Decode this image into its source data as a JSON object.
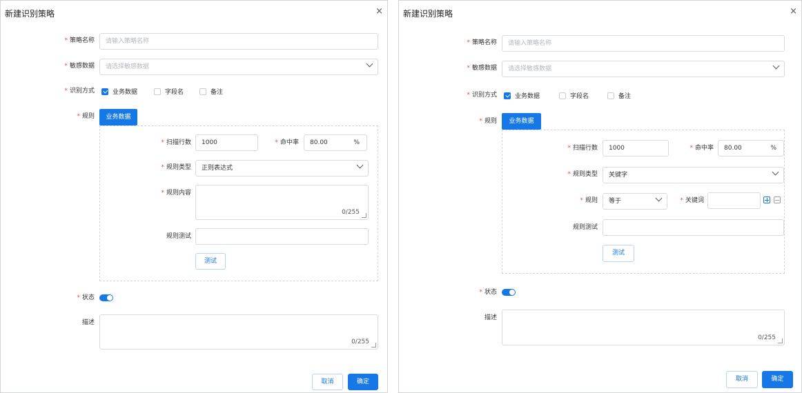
{
  "dialogs": [
    {
      "title": "新建识别策略",
      "close": "×",
      "fields": {
        "name": {
          "label": "策略名称",
          "placeholder": "请输入策略名称"
        },
        "sensitive": {
          "label": "敏感数据",
          "placeholder": "请选择敏感数据"
        },
        "method": {
          "label": "识别方式",
          "options": [
            {
              "label": "业务数据",
              "checked": true
            },
            {
              "label": "字段名",
              "checked": false
            },
            {
              "label": "备注",
              "checked": false
            }
          ]
        },
        "rule": {
          "label": "规则",
          "tab": "业务数据"
        },
        "scan_rows": {
          "label": "扫描行数",
          "value": "1000"
        },
        "hit_rate": {
          "label": "命中率",
          "value": "80.00",
          "unit": "%"
        },
        "rule_type": {
          "label": "规则类型",
          "value": "正则表达式"
        },
        "rule_content": {
          "label": "规则内容",
          "counter": "0/255"
        },
        "rule_test": {
          "label": "规则测试",
          "value": ""
        },
        "test_button": "测试",
        "status": {
          "label": "状态",
          "on": true
        },
        "desc": {
          "label": "描述",
          "counter": "0/255"
        }
      },
      "footer": {
        "cancel": "取消",
        "confirm": "确定"
      }
    },
    {
      "title": "新建识别策略",
      "close": "×",
      "fields": {
        "name": {
          "label": "策略名称",
          "placeholder": "请输入策略名称"
        },
        "sensitive": {
          "label": "敏感数据",
          "placeholder": "请选择敏感数据"
        },
        "method": {
          "label": "识别方式",
          "options": [
            {
              "label": "业务数据",
              "checked": true
            },
            {
              "label": "字段名",
              "checked": false
            },
            {
              "label": "备注",
              "checked": false
            }
          ]
        },
        "rule": {
          "label": "规则",
          "tab": "业务数据"
        },
        "scan_rows": {
          "label": "扫描行数",
          "value": "1000"
        },
        "hit_rate": {
          "label": "命中率",
          "value": "80.00",
          "unit": "%"
        },
        "rule_type": {
          "label": "规则类型",
          "value": "关键字"
        },
        "rule_op": {
          "label": "规则",
          "value": "等于"
        },
        "keyword": {
          "label": "关键词",
          "value": ""
        },
        "rule_test": {
          "label": "规则测试",
          "value": ""
        },
        "test_button": "测试",
        "status": {
          "label": "状态",
          "on": true
        },
        "desc": {
          "label": "描述",
          "counter": "0/255"
        }
      },
      "footer": {
        "cancel": "取消",
        "confirm": "确定"
      }
    }
  ],
  "colors": {
    "accent": "#1677e6",
    "required": "#e34d4d",
    "border": "#d6d9de"
  }
}
